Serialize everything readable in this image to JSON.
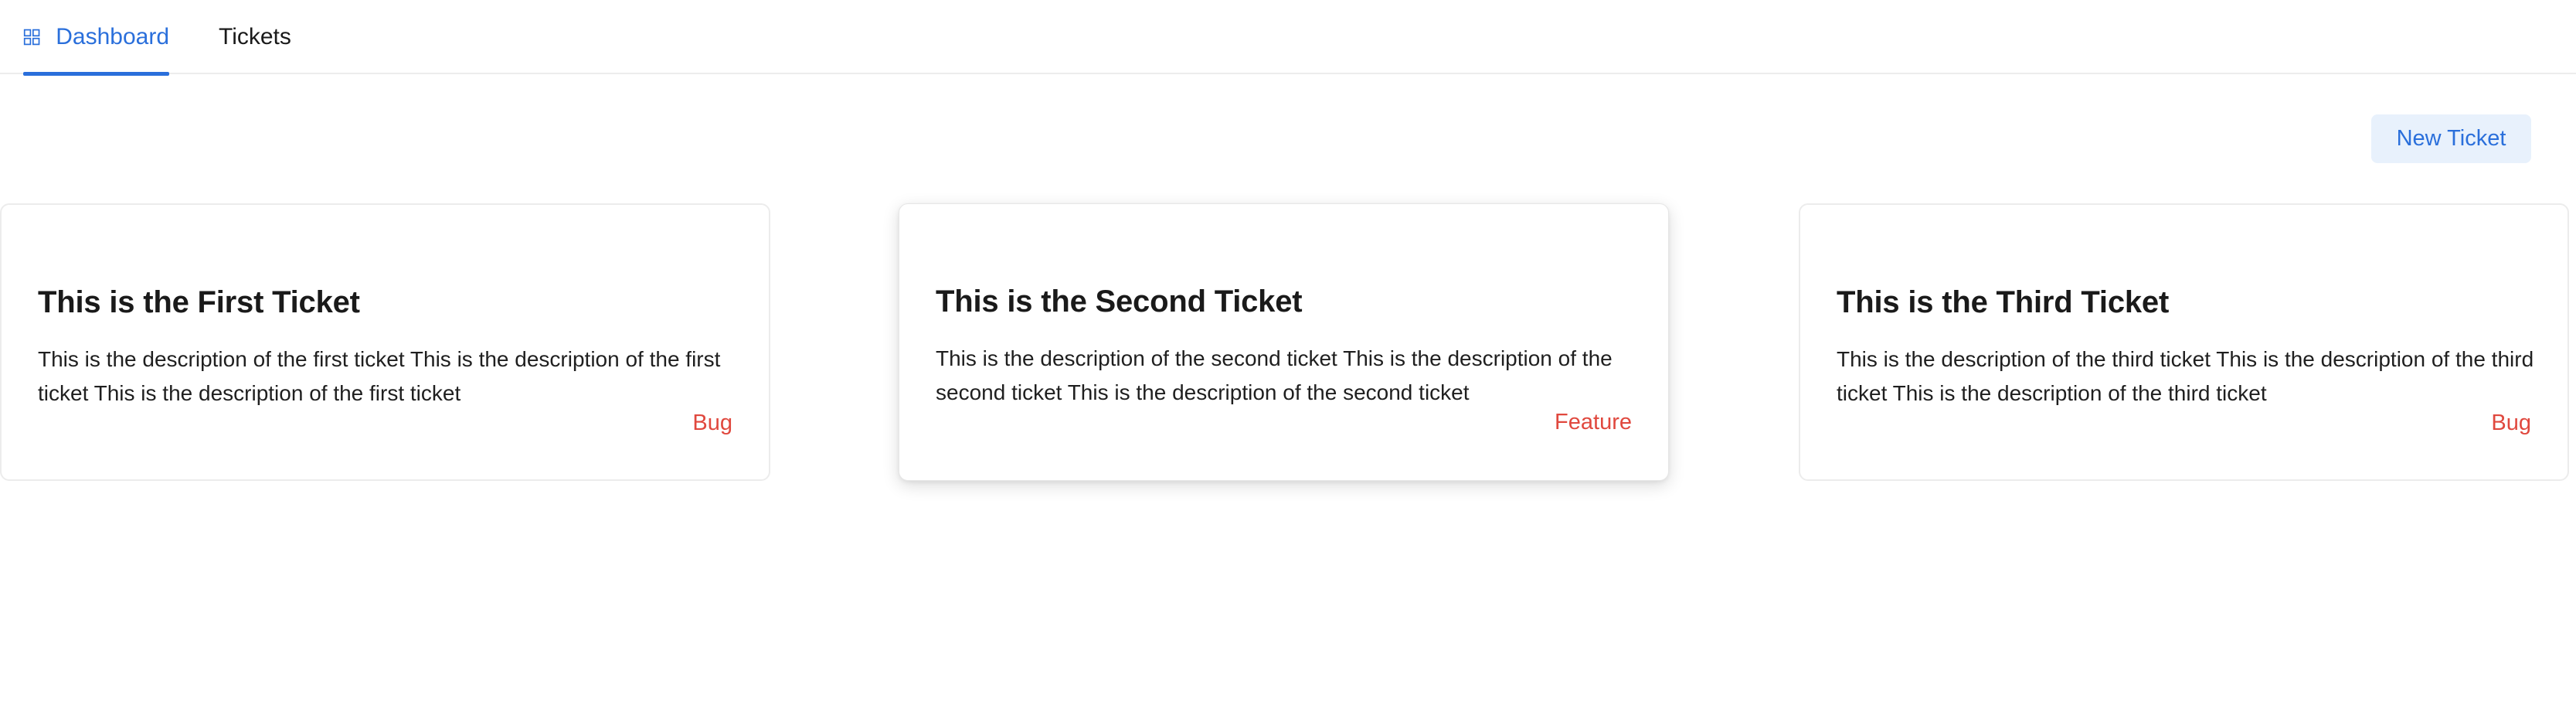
{
  "nav": {
    "tabs": [
      {
        "label": "Dashboard",
        "icon": "grid-icon",
        "active": true
      },
      {
        "label": "Tickets",
        "active": false
      }
    ]
  },
  "toolbar": {
    "new_ticket_label": "New Ticket"
  },
  "tickets": [
    {
      "title": "This is the First Ticket",
      "description": "This is the description of the first ticket This is the description of the first ticket This is the description of the first ticket",
      "tag": "Bug"
    },
    {
      "title": "This is the Second Ticket",
      "description": "This is the description of the second ticket This is the description of the second ticket This is the description of the second ticket",
      "tag": "Feature"
    },
    {
      "title": "This is the Third Ticket",
      "description": "This is the description of the third ticket This is the description of the third ticket This is the description of the third ticket",
      "tag": "Bug"
    }
  ],
  "colors": {
    "accent": "#2a6fdb",
    "accent_bg": "#e8f1fc",
    "tag": "#e0483e",
    "divider": "#ededed"
  }
}
